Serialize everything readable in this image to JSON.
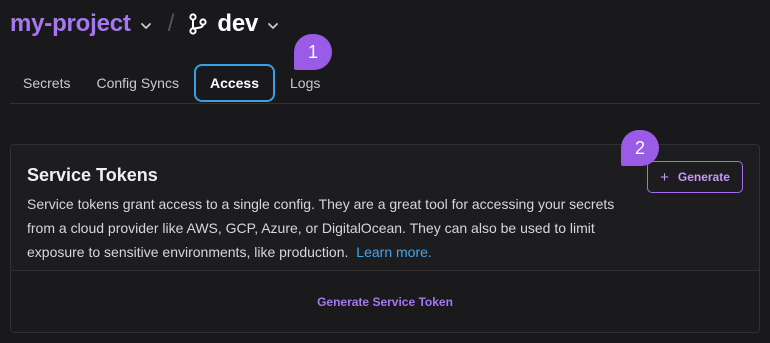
{
  "header": {
    "project": "my-project",
    "separator": "/",
    "branch": "dev"
  },
  "tabs": [
    {
      "label": "Secrets",
      "active": false
    },
    {
      "label": "Config Syncs",
      "active": false
    },
    {
      "label": "Access",
      "active": true
    },
    {
      "label": "Logs",
      "active": false
    }
  ],
  "markers": {
    "one": "1",
    "two": "2"
  },
  "card": {
    "title": "Service Tokens",
    "description": "Service tokens grant access to a single config. They are a great tool for accessing your secrets from a cloud provider like AWS, GCP, Azure, or DigitalOcean. They can also be used to limit exposure to sensitive environments, like production.",
    "learn_more": "Learn more.",
    "generate_label": "Generate",
    "generate_icon": "+",
    "footer_link": "Generate Service Token"
  },
  "colors": {
    "accent": "#a678f0",
    "tab_focus": "#3aa0e6",
    "link": "#3fa7ee",
    "marker": "#9a5ce6"
  },
  "icons": {
    "project_chevron": "chevron-down-icon",
    "branch": "git-branch-icon",
    "branch_chevron": "chevron-down-icon"
  }
}
